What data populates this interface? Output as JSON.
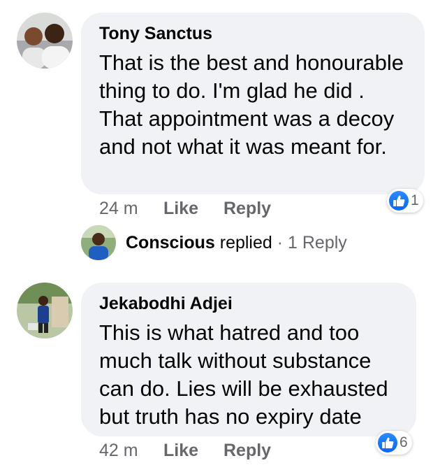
{
  "comments": [
    {
      "author": "Tony Sanctus",
      "text": "That is the best and honourable thing to do. I'm glad he did . That appointment was a decoy and not what it was meant for.",
      "time": "24 m",
      "like_label": "Like",
      "reply_label": "Reply",
      "reaction_count": "1",
      "reaction_icon": "like-icon"
    },
    {
      "author": "Jekabodhi Adjei",
      "text": "This is what hatred and too much talk without substance can do. Lies will be exhausted but truth has no expiry date",
      "time": "42 m",
      "like_label": "Like",
      "reply_label": "Reply",
      "reaction_count": "6",
      "reaction_icon": "like-icon"
    }
  ],
  "reply_thread": {
    "name": "Conscious",
    "action": " replied",
    "separator": " · ",
    "link": "1 Reply"
  },
  "colors": {
    "bubble": "#f0f2f5",
    "meta_text": "#65676b",
    "like_blue": "#0866ff"
  }
}
